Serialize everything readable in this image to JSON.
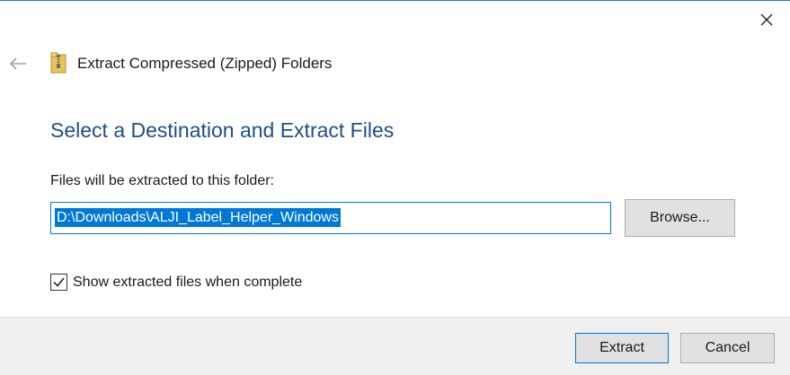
{
  "window": {
    "title": "Extract Compressed (Zipped) Folders",
    "close_icon": "close-icon",
    "back_icon": "back-arrow-icon",
    "folder_icon": "zipped-folder-icon"
  },
  "content": {
    "heading": "Select a Destination and Extract Files",
    "destination_label": "Files will be extracted to this folder:",
    "destination_path": "D:\\Downloads\\ALJI_Label_Helper_Windows",
    "browse_label": "Browse...",
    "show_files_label": "Show extracted files when complete",
    "show_files_checked": true
  },
  "footer": {
    "extract_label": "Extract",
    "cancel_label": "Cancel"
  },
  "colors": {
    "heading": "#1f4e8a",
    "accent": "#0078d7",
    "footer_bg": "#f0f0f0",
    "button_bg": "#e1e1e1"
  }
}
